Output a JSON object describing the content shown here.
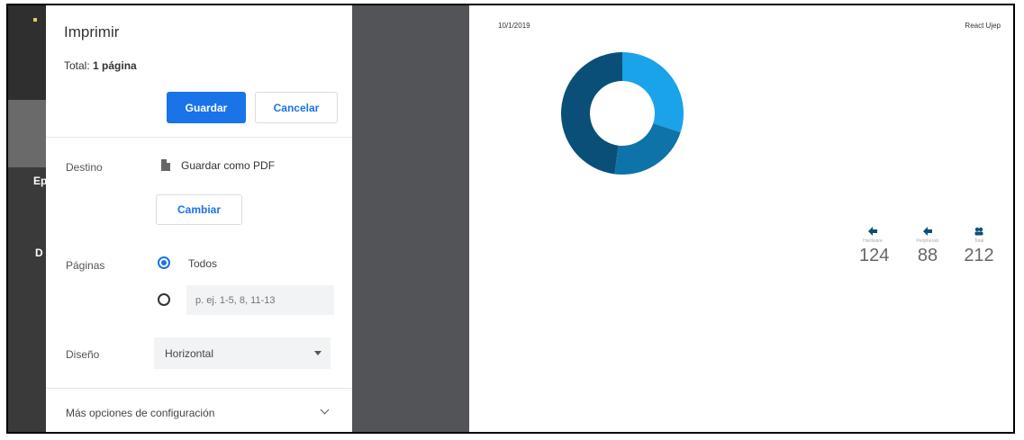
{
  "dialog": {
    "title": "Imprimir",
    "total_label": "Total:",
    "total_value": "1 página",
    "save_label": "Guardar",
    "cancel_label": "Cancelar",
    "destination": {
      "label": "Destino",
      "value": "Guardar como PDF",
      "icon": "file-icon",
      "change_label": "Cambiar"
    },
    "pages": {
      "label": "Páginas",
      "option_all": "Todos",
      "option_all_selected": true,
      "custom_placeholder": "p. ej. 1-5, 8, 11-13"
    },
    "layout": {
      "label": "Diseño",
      "value": "Horizontal"
    },
    "more_options": "Más opciones de configuración"
  },
  "background_app": {
    "letter1": "Ep",
    "letter2": "D"
  },
  "preview": {
    "date": "10/1/2019",
    "app_name": "React Ujep",
    "colors": {
      "light": "#1aa3e8",
      "mid": "#0e73a9",
      "dark": "#0a4f78"
    },
    "stats": [
      {
        "caption": "Hardware",
        "value": "124",
        "icon": "arrow-left-icon"
      },
      {
        "caption": "Peripherals",
        "value": "88",
        "icon": "arrow-left-icon"
      },
      {
        "caption": "Total",
        "value": "212",
        "icon": "group-icon"
      }
    ]
  },
  "chart_data": {
    "type": "pie",
    "categories": [
      "",
      "",
      ""
    ],
    "values": [
      30,
      22,
      48
    ],
    "title": ""
  }
}
